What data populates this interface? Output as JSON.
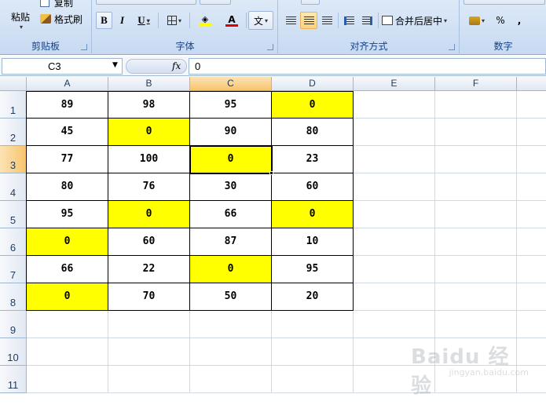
{
  "ribbon": {
    "clipboard": {
      "label": "剪贴板",
      "paste_label": "粘贴",
      "copy_label": "复制",
      "format_painter_label": "格式刷"
    },
    "font": {
      "label": "字体",
      "bold": "B",
      "italic": "I",
      "underline": "U",
      "font_color_glyph": "A",
      "phonetic_glyph": "文"
    },
    "alignment": {
      "label": "对齐方式",
      "merge_center_label": "合并后居中"
    },
    "number": {
      "label": "数字",
      "percent": "%",
      "comma": ","
    }
  },
  "formula_bar": {
    "name_box": "C3",
    "fx": "fx",
    "formula": "0"
  },
  "columns": [
    "A",
    "B",
    "C",
    "D",
    "E",
    "F"
  ],
  "rows": [
    "1",
    "2",
    "3",
    "4",
    "5",
    "6",
    "7",
    "8",
    "9",
    "10",
    "11"
  ],
  "selected": {
    "column": "C",
    "row": "3"
  },
  "table": [
    [
      "89",
      "98",
      "95",
      "0"
    ],
    [
      "45",
      "0",
      "90",
      "80"
    ],
    [
      "77",
      "100",
      "0",
      "23"
    ],
    [
      "80",
      "76",
      "30",
      "60"
    ],
    [
      "95",
      "0",
      "66",
      "0"
    ],
    [
      "0",
      "60",
      "87",
      "10"
    ],
    [
      "66",
      "22",
      "0",
      "95"
    ],
    [
      "0",
      "70",
      "50",
      "20"
    ]
  ],
  "highlight_color": "#ffff00",
  "watermark": {
    "brand": "Baidu 经验",
    "url": "jingyan.baidu.com"
  }
}
